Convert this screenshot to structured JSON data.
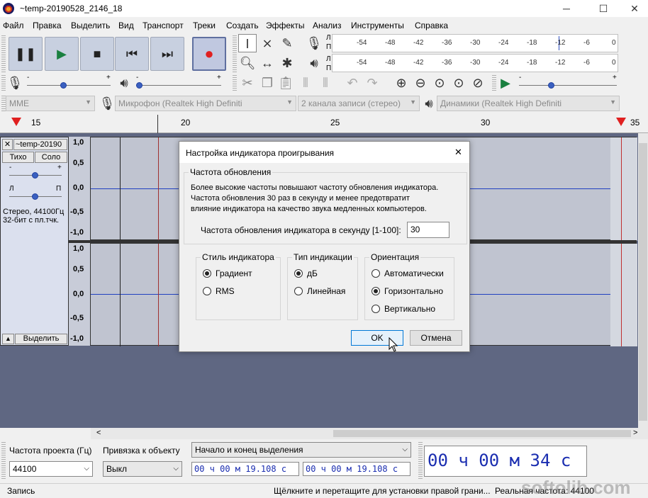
{
  "window": {
    "title": "~temp-20190528_2146_18",
    "minimize": "─",
    "maximize": "☐",
    "close": "✕"
  },
  "menu": [
    "Файл",
    "Правка",
    "Выделить",
    "Вид",
    "Транспорт",
    "Треки",
    "Создать",
    "Эффекты",
    "Анализ",
    "Инструменты",
    "Справка"
  ],
  "meters": {
    "record_l": "Л",
    "record_r": "П",
    "play_l": "Л",
    "play_r": "П",
    "ticks": [
      "-54",
      "-48",
      "-42",
      "-36",
      "-30",
      "-24",
      "-18",
      "-12",
      "-6",
      "0"
    ]
  },
  "sliders": {
    "record_min": "-",
    "record_max": "+",
    "play_min": "-",
    "play_max": "+",
    "speed_min": "-",
    "speed_max": "+"
  },
  "devices": {
    "host": "MME",
    "mic": "Микрофон (Realtek High Definiti",
    "channels": "2 канала записи (стерео)",
    "speakers": "Динамики (Realtek High Definiti"
  },
  "ruler": {
    "labels": [
      "15",
      "20",
      "25",
      "30",
      "35"
    ]
  },
  "track": {
    "close": "✕",
    "name": "~temp-20190",
    "mute": "Тихо",
    "solo": "Соло",
    "gain_min": "-",
    "gain_max": "+",
    "pan_left": "Л",
    "pan_right": "П",
    "info1": "Стерео, 44100Гц",
    "info2": "32-бит с пл.тчк.",
    "select": "Выделить",
    "collapse": "▲",
    "scale_top": [
      "1,0",
      "0,5",
      "0,0",
      "-0,5",
      "-1,0"
    ],
    "scale_bottom": [
      "1,0",
      "0,5",
      "0,0",
      "-0,5",
      "-1,0"
    ]
  },
  "dialog": {
    "title": "Настройка индикатора проигрывания",
    "close": "✕",
    "refresh_group": "Частота обновления",
    "refresh_text1": "Более высокие частоты повышают частоту обновления индикатора.",
    "refresh_text2": "Частота обновления 30 раз в секунду и менее предотвратит",
    "refresh_text3": "влияние индикатора на качество звука медленных компьютеров.",
    "rate_label": "Частота обновления индикатора в секунду [1-100]:",
    "rate_value": "30",
    "style_group": "Стиль индикатора",
    "style_gradient": "Градиент",
    "style_rms": "RMS",
    "type_group": "Тип индикации",
    "type_db": "дБ",
    "type_linear": "Линейная",
    "orient_group": "Ориентация",
    "orient_auto": "Автоматически",
    "orient_horizontal": "Горизонтально",
    "orient_vertical": "Вертикально",
    "ok": "OK",
    "cancel": "Отмена"
  },
  "scrollbar": {
    "left": "<",
    "right": ">"
  },
  "bottom": {
    "rate_label": "Частота проекта (Гц)",
    "rate_value": "44100",
    "snap_label": "Привязка к объекту",
    "snap_value": "Выкл",
    "selection_mode": "Начало и конец выделения",
    "sel_start": "00 ч 00 м 19.108 с",
    "sel_end": "00 ч 00 м 19.108 с",
    "time_display": "00 ч 00 м 34 с"
  },
  "status": {
    "state": "Запись",
    "hint": "Щёлкните и перетащите для установки правой грани...",
    "actual_rate": "Реальная частота: 44100",
    "watermark": "softolib.com"
  },
  "colors": {
    "accent": "#3a60c0",
    "record": "#e02020",
    "track_bg": "#5f6782",
    "time_text": "#1a2db0"
  }
}
